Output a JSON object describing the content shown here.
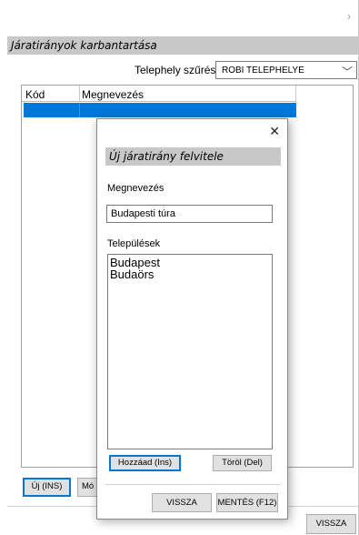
{
  "window": {
    "close_glyph": "›"
  },
  "main": {
    "title": "Járatirányok karbantartása",
    "filter_label": "Telephely szűrés:",
    "filter_value": "ROBI TELEPHELYE",
    "grid": {
      "columns": [
        "Kód",
        "Megnevezés"
      ],
      "rows": [
        {
          "kod": "",
          "megnevezes": "",
          "selected": true
        }
      ]
    },
    "buttons": {
      "new_label": "Új (INS)",
      "modify_label": "Mó",
      "back_label": "VISSZA"
    }
  },
  "dialog": {
    "close_glyph": "✕",
    "title": "Új járatirány felvitele",
    "name_label": "Megnevezés",
    "name_value": "Budapesti túra",
    "towns_label": "Települések",
    "towns": [
      "Budapest",
      "Budaörs"
    ],
    "add_label": "Hozzáad (Ins)",
    "delete_label": "Töröl (Del)",
    "back_label": "VISSZA",
    "save_label": "MENTÉS (F12)"
  },
  "colors": {
    "selection": "#0078d7",
    "title_bar": "#c8c8c8",
    "button_face": "#e1e1e1"
  }
}
